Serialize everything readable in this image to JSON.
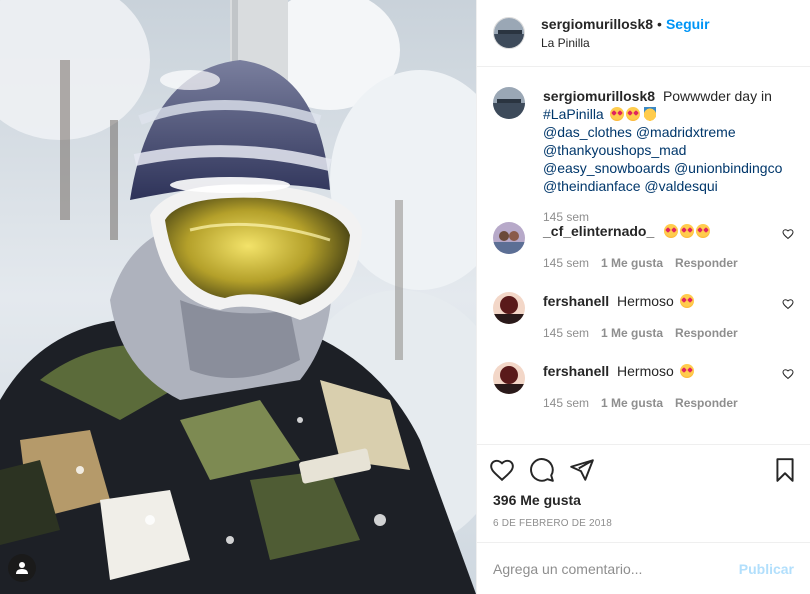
{
  "post": {
    "author": "sergiomurillosk8",
    "follow_label": "Seguir",
    "dot": "•",
    "location": "La Pinilla"
  },
  "caption": {
    "user": "sergiomurillosk8",
    "text": "Powwwder day in",
    "hashtag": "#LaPinilla",
    "mentions": [
      "@das_clothes @madridxtreme",
      "@thankyoushops_mad",
      "@easy_snowboards @unionbindingco",
      "@theindianface @valdesqui"
    ],
    "time": "145 sem"
  },
  "comments": [
    {
      "user": "_cf_elinternado_",
      "text": "",
      "time": "145 sem",
      "likes": "1 Me gusta",
      "reply": "Responder"
    },
    {
      "user": "fershanell",
      "text": "Hermoso",
      "time": "145 sem",
      "likes": "1 Me gusta",
      "reply": "Responder"
    },
    {
      "user": "fershanell",
      "text": "Hermoso",
      "time": "145 sem",
      "likes": "1 Me gusta",
      "reply": "Responder"
    }
  ],
  "stats": {
    "likes": "396 Me gusta",
    "date": "6 DE FEBRERO DE 2018"
  },
  "composer": {
    "placeholder": "Agrega un comentario...",
    "publish_label": "Publicar"
  },
  "icons": [
    "heart-icon",
    "comment-icon",
    "share-icon",
    "bookmark-icon",
    "user-tag-icon",
    "small-heart-icon"
  ],
  "colors": {
    "link": "#00376b",
    "follow": "#0095f6",
    "muted": "#8e8e8e",
    "publish_disabled": "#b2dffc"
  }
}
